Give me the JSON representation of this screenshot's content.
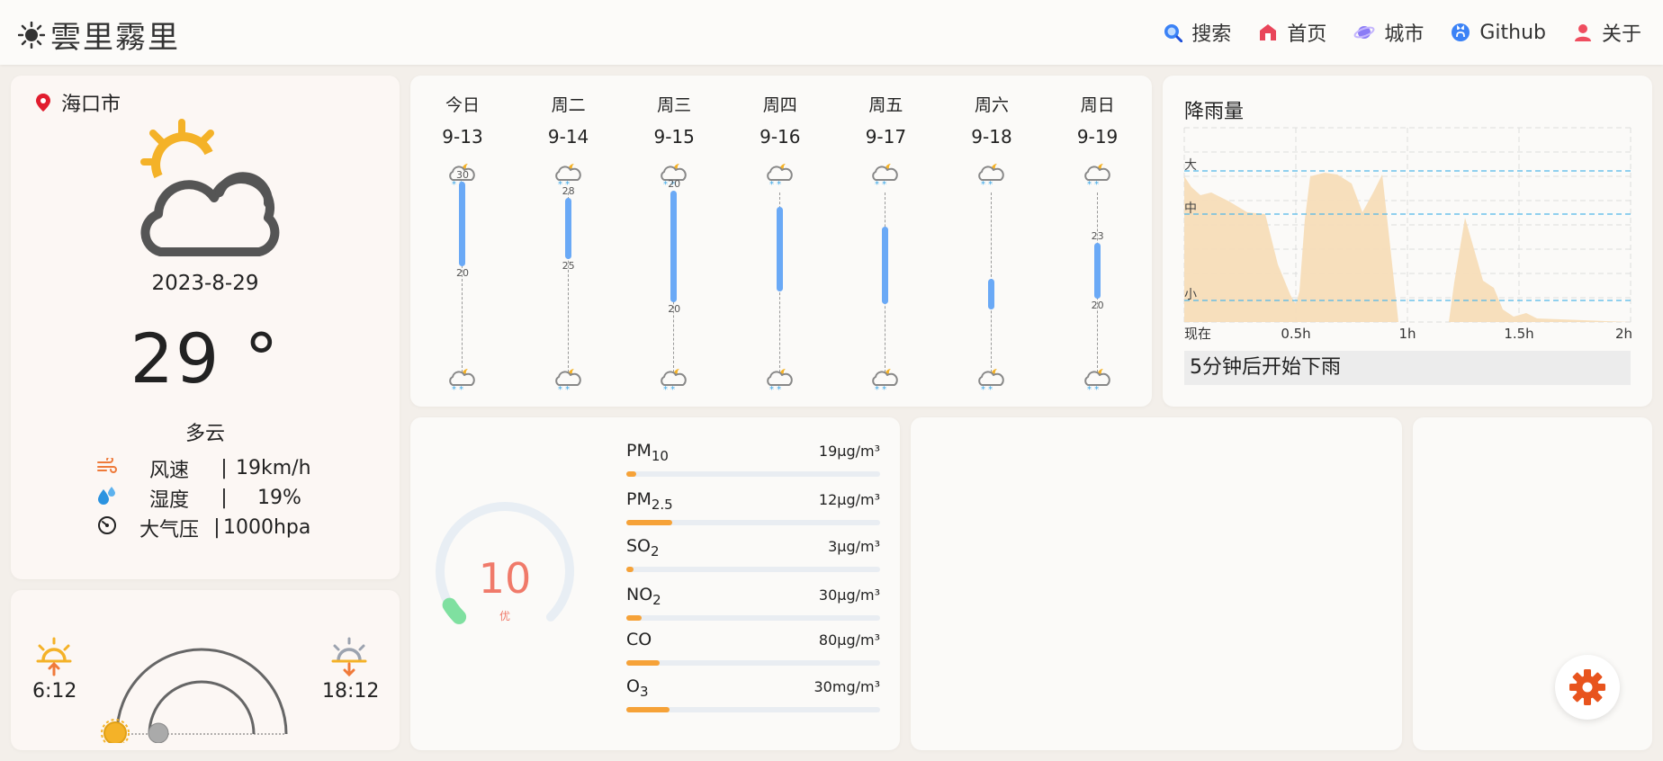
{
  "app": {
    "title": "雲里霧里"
  },
  "nav": [
    {
      "label": "搜索",
      "icon": "search-icon"
    },
    {
      "label": "首页",
      "icon": "home-icon"
    },
    {
      "label": "城市",
      "icon": "planet-icon"
    },
    {
      "label": "Github",
      "icon": "github-icon"
    },
    {
      "label": "关于",
      "icon": "user-icon"
    }
  ],
  "current": {
    "city": "海口市",
    "date": "2023-8-29",
    "temperature": "29 °",
    "condition": "多云",
    "wind": {
      "label": "风速",
      "value": "19km/h"
    },
    "humidity": {
      "label": "湿度",
      "value": "19%"
    },
    "pressure": {
      "label": "大气压",
      "value": "1000hpa"
    },
    "separator": "|"
  },
  "sun": {
    "sunrise": "6:12",
    "sunset": "18:12"
  },
  "forecast": [
    {
      "day": "今日",
      "date": "9-13",
      "high": "30",
      "low": "20"
    },
    {
      "day": "周二",
      "date": "9-14",
      "high": "28",
      "low": "25"
    },
    {
      "day": "周三",
      "date": "9-15",
      "high": "20",
      "low": "20"
    },
    {
      "day": "周四",
      "date": "9-16",
      "high": "",
      "low": ""
    },
    {
      "day": "周五",
      "date": "9-17",
      "high": "",
      "low": ""
    },
    {
      "day": "周六",
      "date": "9-18",
      "high": "",
      "low": ""
    },
    {
      "day": "周日",
      "date": "9-19",
      "high": "23",
      "low": "20"
    }
  ],
  "rain": {
    "title": "降雨量",
    "levels": [
      "大",
      "中",
      "小"
    ],
    "x_ticks": [
      "现在",
      "0.5h",
      "1h",
      "1.5h",
      "2h"
    ],
    "summary": "5分钟后开始下雨"
  },
  "air": {
    "aqi": "10",
    "aqi_level": "优",
    "aqi_fraction": 0.05,
    "pollutants": [
      {
        "name": "PM",
        "sub": "10",
        "value": "19μg/m³",
        "fraction": 0.04
      },
      {
        "name": "PM",
        "sub": "2.5",
        "value": "12μg/m³",
        "fraction": 0.18
      },
      {
        "name": "SO",
        "sub": "2",
        "value": "3μg/m³",
        "fraction": 0.03
      },
      {
        "name": "NO",
        "sub": "2",
        "value": "30μg/m³",
        "fraction": 0.06
      },
      {
        "name": "CO",
        "sub": "",
        "value": "80μg/m³",
        "fraction": 0.13
      },
      {
        "name": "O",
        "sub": "3",
        "value": "30mg/m³",
        "fraction": 0.17
      }
    ]
  },
  "colors": {
    "accent_blue": "#6aa9f6",
    "rain_fill": "#f7ddb8",
    "aqi_text": "#f07a6a",
    "bar_orange": "#f6a238",
    "gear": "#e8541e"
  }
}
